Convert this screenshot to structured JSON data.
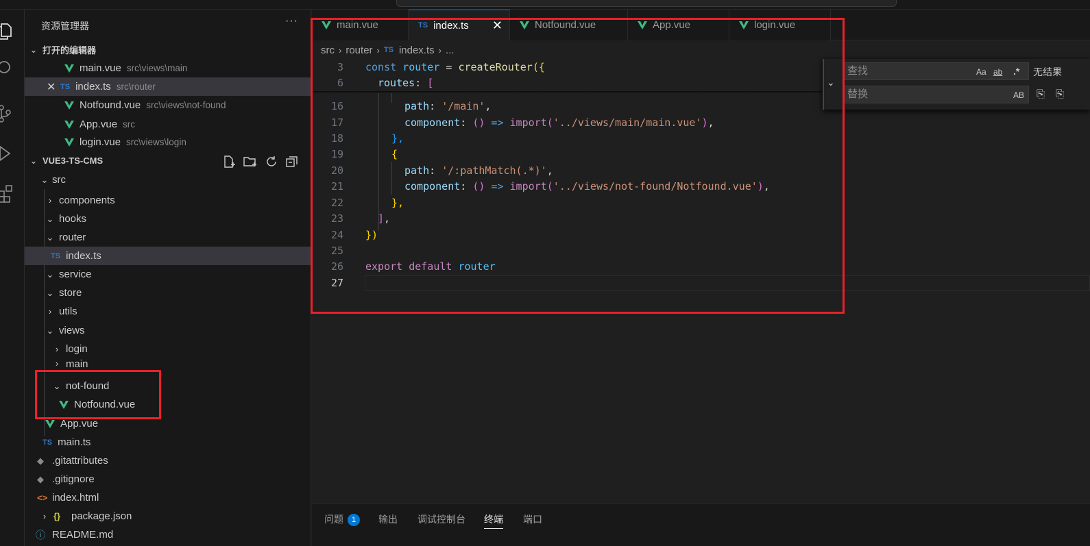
{
  "sidebar": {
    "title": "资源管理器",
    "more": "···",
    "open_editors": {
      "header": "打开的编辑器",
      "items": [
        {
          "name": "main.vue",
          "path": "src\\views\\main",
          "icon": "vue-icon"
        },
        {
          "name": "index.ts",
          "path": "src\\router",
          "icon": "ts-icon"
        },
        {
          "name": "Notfound.vue",
          "path": "src\\views\\not-found",
          "icon": "vue-icon"
        },
        {
          "name": "App.vue",
          "path": "src",
          "icon": "vue-icon"
        },
        {
          "name": "login.vue",
          "path": "src\\views\\login",
          "icon": "vue-icon"
        }
      ]
    },
    "project": {
      "header": "VUE3-TS-CMS",
      "tree": [
        {
          "label": "src"
        },
        {
          "label": "components"
        },
        {
          "label": "hooks"
        },
        {
          "label": "router"
        },
        {
          "label": "index.ts"
        },
        {
          "label": "service"
        },
        {
          "label": "store"
        },
        {
          "label": "utils"
        },
        {
          "label": "views"
        },
        {
          "label": "login"
        },
        {
          "label": "main"
        },
        {
          "label": "not-found"
        },
        {
          "label": "Notfound.vue"
        },
        {
          "label": "App.vue"
        },
        {
          "label": "main.ts"
        },
        {
          "label": ".gitattributes"
        },
        {
          "label": ".gitignore"
        },
        {
          "label": "index.html"
        },
        {
          "label": "package.json"
        },
        {
          "label": "README.md"
        }
      ]
    }
  },
  "tabs": [
    {
      "label": "main.vue"
    },
    {
      "label": "index.ts"
    },
    {
      "label": "Notfound.vue"
    },
    {
      "label": "App.vue"
    },
    {
      "label": "login.vue"
    }
  ],
  "tab_icon_ts": "TS",
  "breadcrumb": [
    "src",
    "router",
    "index.ts",
    "..."
  ],
  "code": {
    "l3": {
      "n": "3",
      "const": "const",
      "name": "router",
      "eq": " = ",
      "fn": "createRouter",
      "open": "({"
    },
    "l6": {
      "n": "6",
      "key": "routes",
      "colon": ": ",
      "br": "["
    },
    "l16": {
      "n": "16",
      "key": "path",
      "colon": ": ",
      "str": "'/main'",
      "end": ","
    },
    "l17": {
      "n": "17",
      "key": "component",
      "colon": ": ",
      "arrow1": "()",
      "arrow2": " => ",
      "imp": "import",
      "p1": "(",
      "str": "'../views/main/main.vue'",
      "p2": ")",
      "end": ","
    },
    "l18": {
      "n": "18",
      "text": "},"
    },
    "l19": {
      "n": "19",
      "text": "{"
    },
    "l20": {
      "n": "20",
      "key": "path",
      "colon": ": ",
      "str": "'/:pathMatch(.*)'",
      "end": ","
    },
    "l21": {
      "n": "21",
      "key": "component",
      "colon": ": ",
      "arrow1": "()",
      "arrow2": " => ",
      "imp": "import",
      "p1": "(",
      "str": "'../views/not-found/Notfound.vue'",
      "p2": ")",
      "end": ","
    },
    "l22": {
      "n": "22",
      "text": "},"
    },
    "l23": {
      "n": "23",
      "br": "]",
      "end": ","
    },
    "l24": {
      "n": "24",
      "close": "})"
    },
    "l25": {
      "n": "25"
    },
    "l26": {
      "n": "26",
      "exp": "export",
      "def": " default ",
      "name": "router"
    },
    "l27": {
      "n": "27"
    }
  },
  "find": {
    "find_placeholder": "查找",
    "replace_placeholder": "替换",
    "match_case": "Aa",
    "whole_word": "ab",
    "regex": ".*",
    "preserve_case": "AB",
    "no_results": "无结果"
  },
  "panel": {
    "tabs": [
      {
        "label": "问题",
        "badge": "1"
      },
      {
        "label": "输出"
      },
      {
        "label": "调试控制台"
      },
      {
        "label": "终端"
      },
      {
        "label": "端口"
      }
    ]
  },
  "colors": {
    "accent": "#0078d4",
    "annotation": "#e8212b",
    "vue": "#41b883",
    "ts": "#3178c6"
  }
}
